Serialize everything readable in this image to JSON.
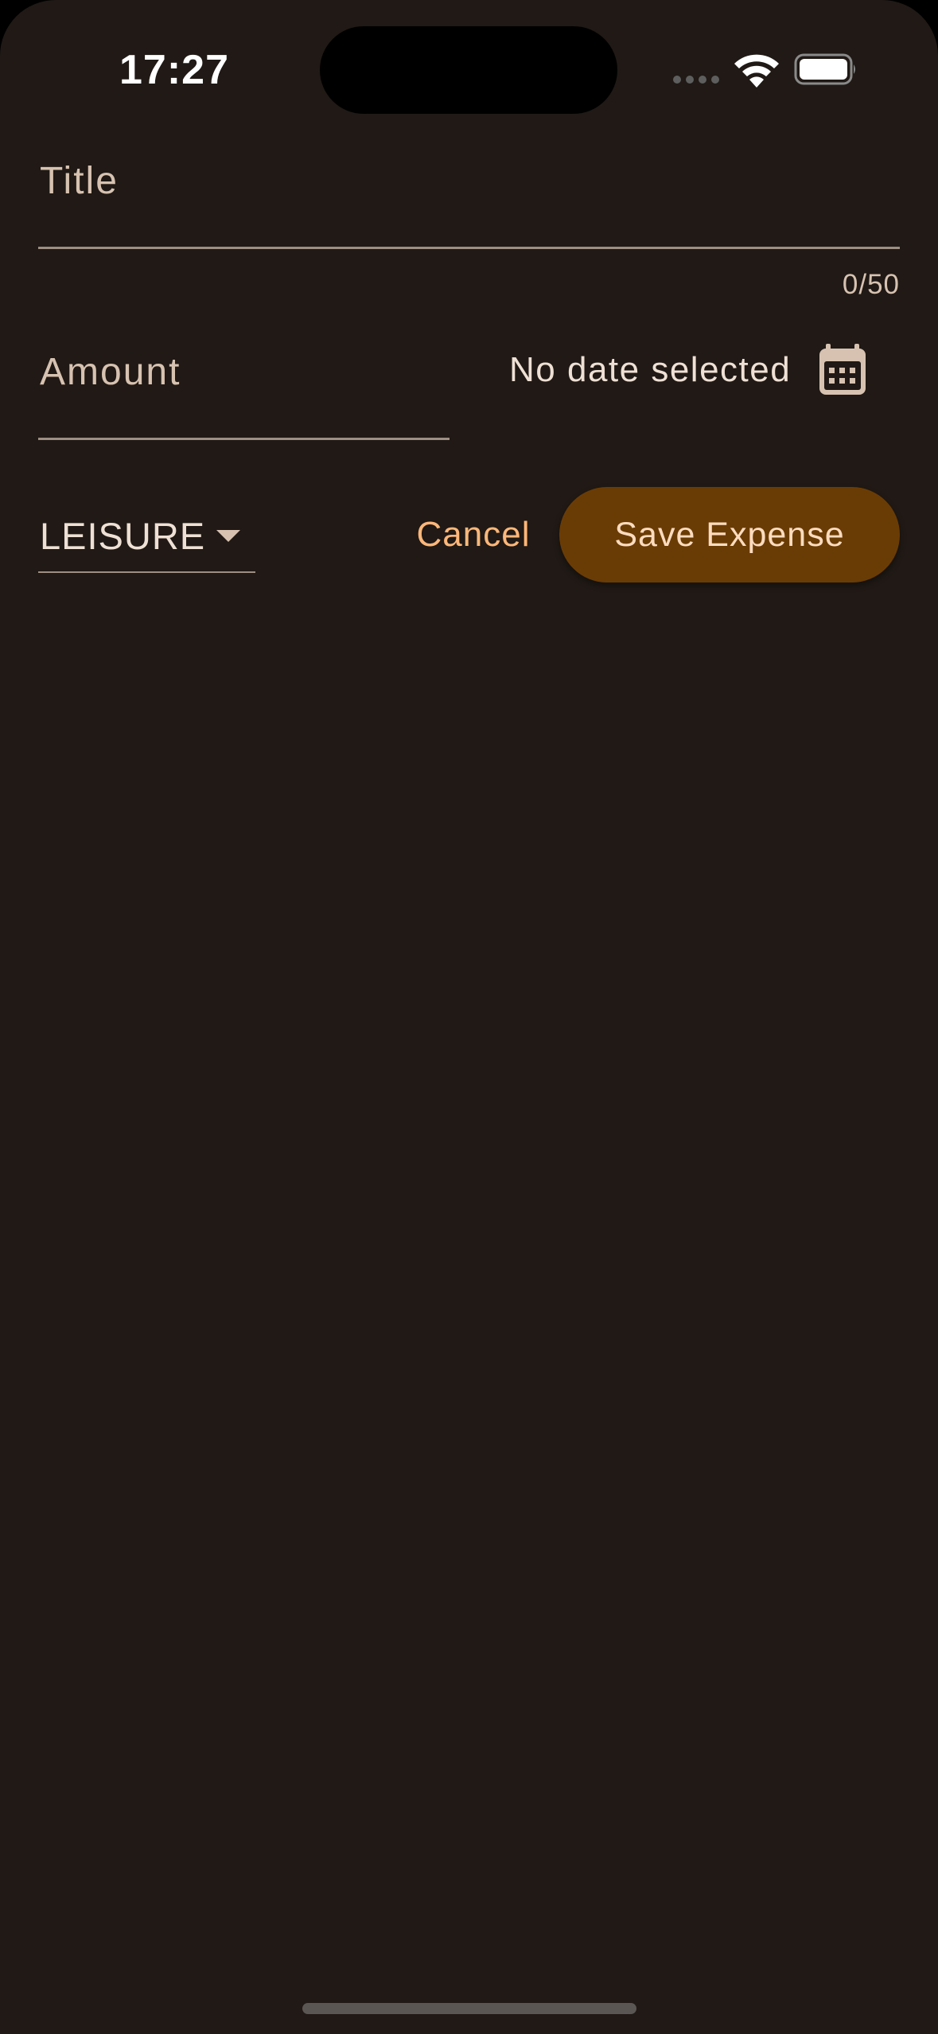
{
  "status_bar": {
    "time": "17:27"
  },
  "form": {
    "title": {
      "label": "Title",
      "value": "",
      "counter": "0/50"
    },
    "amount": {
      "label": "Amount",
      "value": ""
    },
    "date": {
      "text": "No date selected",
      "icon": "calendar-icon"
    },
    "category": {
      "value": "LEISURE",
      "icon": "dropdown-arrow-icon"
    },
    "actions": {
      "cancel_label": "Cancel",
      "save_label": "Save Expense"
    }
  },
  "colors": {
    "background": "#201915",
    "accent": "#ffb77a",
    "button_fill": "#6a3c05",
    "label": "#d7c2b1"
  }
}
